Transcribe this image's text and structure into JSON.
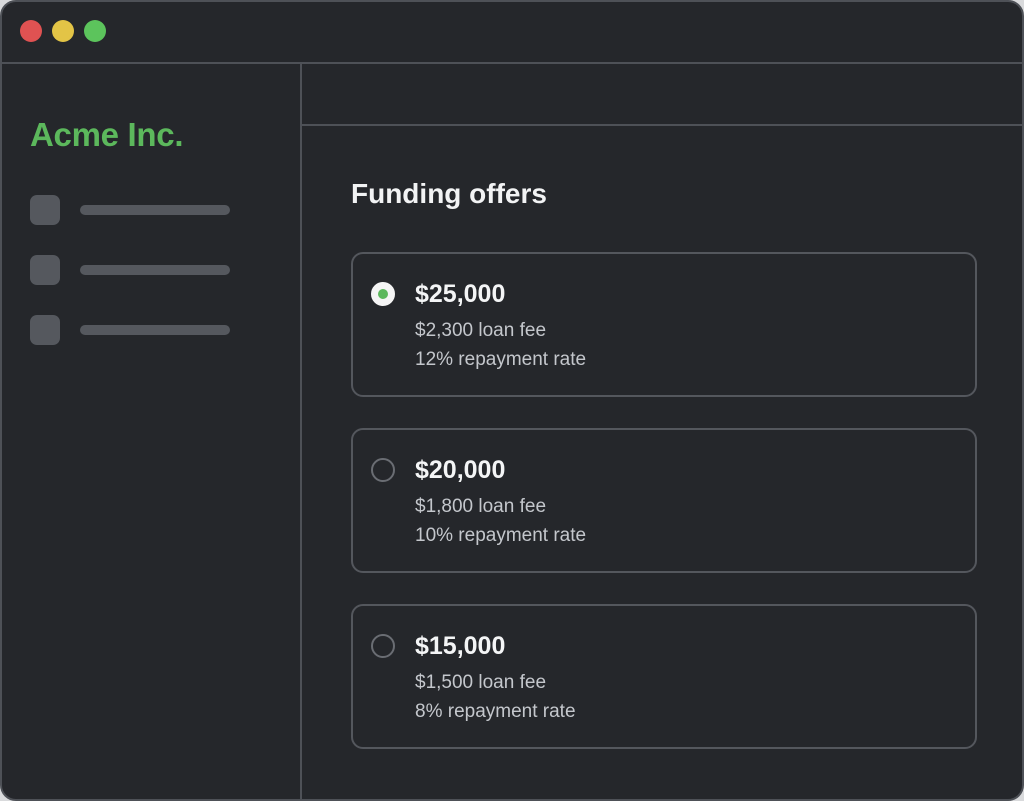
{
  "colors": {
    "brand": "#5cb85c",
    "traffic_red": "#e05252",
    "traffic_yellow": "#e3c446",
    "traffic_green": "#5cc45c",
    "selected_dot": "#5cb85c"
  },
  "titlebar": {
    "buttons": [
      "close-button",
      "minimize-button",
      "maximize-button"
    ]
  },
  "sidebar": {
    "brand": "Acme Inc.",
    "items": [
      {
        "icon": "placeholder-icon"
      },
      {
        "icon": "placeholder-icon"
      },
      {
        "icon": "placeholder-icon"
      }
    ]
  },
  "main": {
    "title": "Funding offers",
    "offers": [
      {
        "amount": "$25,000",
        "fee": "$2,300 loan fee",
        "rate": "12% repayment rate",
        "selected": true
      },
      {
        "amount": "$20,000",
        "fee": "$1,800 loan fee",
        "rate": "10% repayment rate",
        "selected": false
      },
      {
        "amount": "$15,000",
        "fee": "$1,500 loan fee",
        "rate": "8% repayment rate",
        "selected": false
      }
    ]
  }
}
